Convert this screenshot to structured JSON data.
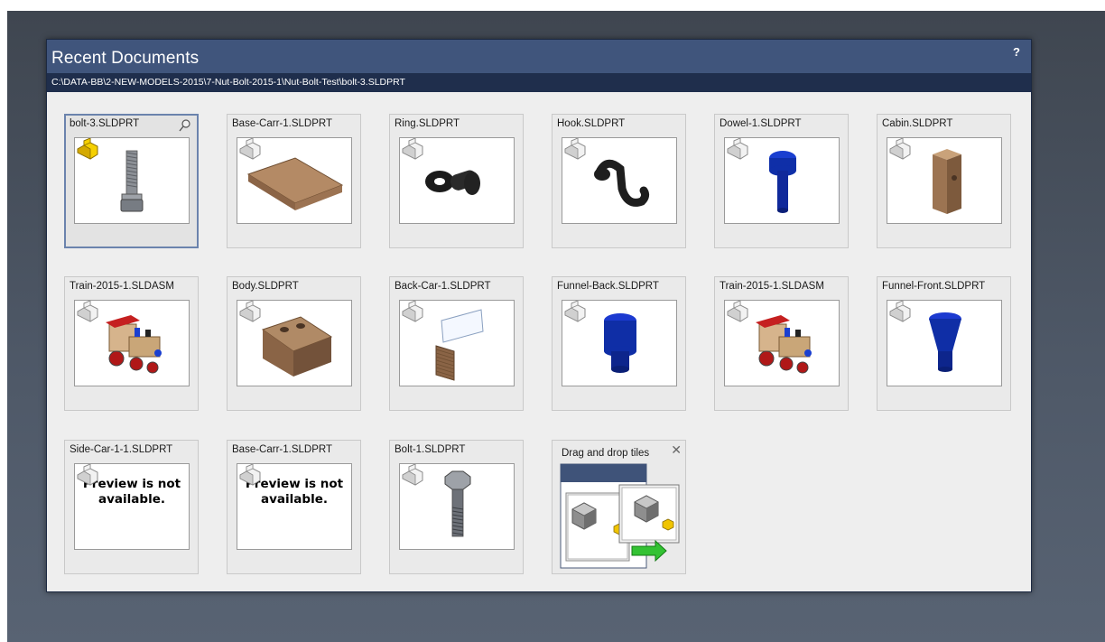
{
  "dialog": {
    "title": "Recent Documents",
    "help_label": "?",
    "path": "C:\\DATA-BB\\2-NEW-MODELS-2015\\7-Nut-Bolt-2015-1\\Nut-Bolt-Test\\bolt-3.SLDPRT"
  },
  "tiles": [
    {
      "name": "bolt-3.SLDPRT",
      "type": "part",
      "preview": "bolt-icon",
      "selected": true
    },
    {
      "name": "Base-Carr-1.SLDPRT",
      "type": "part",
      "preview": "wood-plank-icon"
    },
    {
      "name": "Ring.SLDPRT",
      "type": "part",
      "preview": "eye-bolt-icon"
    },
    {
      "name": "Hook.SLDPRT",
      "type": "part",
      "preview": "hook-icon"
    },
    {
      "name": "Dowel-1.SLDPRT",
      "type": "part",
      "preview": "blue-peg-icon"
    },
    {
      "name": "Cabin.SLDPRT",
      "type": "part",
      "preview": "wood-block-icon"
    },
    {
      "name": "Train-2015-1.SLDASM",
      "type": "assembly",
      "preview": "toy-train-icon"
    },
    {
      "name": "Body.SLDPRT",
      "type": "part",
      "preview": "wood-body-icon"
    },
    {
      "name": "Back-Car-1.SLDPRT",
      "type": "part",
      "preview": "back-car-icon"
    },
    {
      "name": "Funnel-Back.SLDPRT",
      "type": "part",
      "preview": "funnel-back-icon"
    },
    {
      "name": "Train-2015-1.SLDASM",
      "type": "assembly",
      "preview": "toy-train-icon"
    },
    {
      "name": "Funnel-Front.SLDPRT",
      "type": "part",
      "preview": "funnel-front-icon"
    },
    {
      "name": "Side-Car-1-1.SLDPRT",
      "type": "part",
      "preview": "none",
      "preview_text": "Preview is not available."
    },
    {
      "name": "Base-Carr-1.SLDPRT",
      "type": "part",
      "preview": "none",
      "preview_text": "Preview is not available."
    },
    {
      "name": "Bolt-1.SLDPRT",
      "type": "part",
      "preview": "hex-bolt-icon"
    }
  ],
  "dnd_tile": {
    "title": "Drag and drop tiles",
    "close_label": "✕"
  },
  "colors": {
    "header": "#40557c",
    "path_bar": "#1f2e4c",
    "selected_border": "#6b83ad",
    "badge_selected": "#f5d000"
  }
}
